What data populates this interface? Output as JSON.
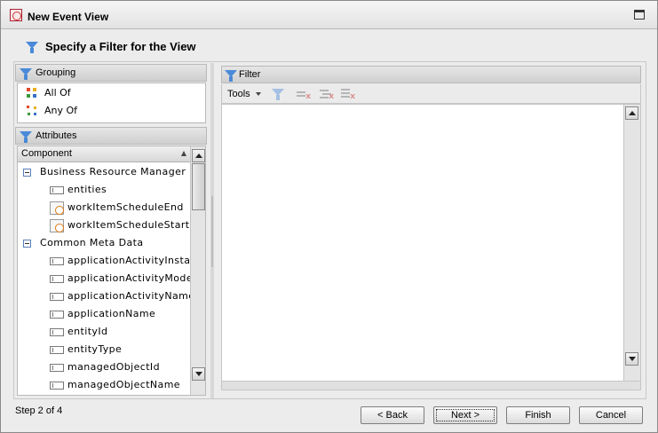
{
  "window": {
    "title": "New Event View"
  },
  "header": {
    "title": "Specify a Filter for the View"
  },
  "grouping": {
    "title": "Grouping",
    "options": [
      {
        "label": "All Of"
      },
      {
        "label": "Any Of"
      }
    ]
  },
  "attributes": {
    "title": "Attributes",
    "column_header": "Component",
    "tree": [
      {
        "label": "Business Resource Manager",
        "type": "group"
      },
      {
        "label": "entities",
        "type": "field"
      },
      {
        "label": "workItemScheduleEnd",
        "type": "time"
      },
      {
        "label": "workItemScheduleStart",
        "type": "time"
      },
      {
        "label": "Common Meta Data",
        "type": "group"
      },
      {
        "label": "applicationActivityInstanceId",
        "type": "field"
      },
      {
        "label": "applicationActivityModelId",
        "type": "field"
      },
      {
        "label": "applicationActivityName",
        "type": "field"
      },
      {
        "label": "applicationName",
        "type": "field"
      },
      {
        "label": "entityId",
        "type": "field"
      },
      {
        "label": "entityType",
        "type": "field"
      },
      {
        "label": "managedObjectId",
        "type": "field"
      },
      {
        "label": "managedObjectName",
        "type": "field"
      }
    ]
  },
  "filter": {
    "title": "Filter",
    "toolbar": {
      "tools_label": "Tools"
    },
    "icons": [
      "filter-add-icon",
      "remove-condition-icon",
      "remove-group-icon",
      "clear-all-icon"
    ]
  },
  "footer": {
    "step": "Step 2 of 4",
    "back": "< Back",
    "next": "Next >",
    "finish": "Finish",
    "cancel": "Cancel"
  }
}
